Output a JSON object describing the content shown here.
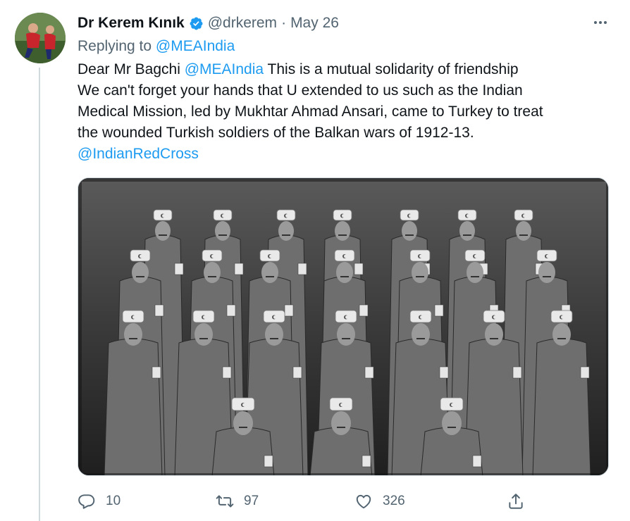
{
  "author": {
    "name": "Dr Kerem Kınık",
    "handle": "@drkerem",
    "separator": "·",
    "date": "May 26",
    "verified_color": "#1d9bf0"
  },
  "reply_context": {
    "prefix": "Replying to",
    "target": "@MEAIndia"
  },
  "tweet": {
    "lines": [
      {
        "before": "Dear Mr Bagchi ",
        "mention": "@MEAIndia",
        "after": " This is a mutual solidarity of friendship"
      },
      {
        "text": "We can't forget your hands that U extended to us such as the Indian"
      },
      {
        "text": "Medical Mission, led by Mukhtar Ahmad Ansari, came to Turkey to treat"
      },
      {
        "text": "the wounded Turkish soldiers of the Balkan wars of 1912-13."
      },
      {
        "mention": "@IndianRedCross"
      }
    ]
  },
  "media": {
    "description_icon": "group-photo",
    "tone": "black-and-white"
  },
  "actions": {
    "reply_count": "10",
    "retweet_count": "97",
    "like_count": "326"
  },
  "colors": {
    "accent": "#1d9bf0",
    "secondary_text": "#536471",
    "primary_text": "#0f1419",
    "border": "#cfd9de"
  }
}
